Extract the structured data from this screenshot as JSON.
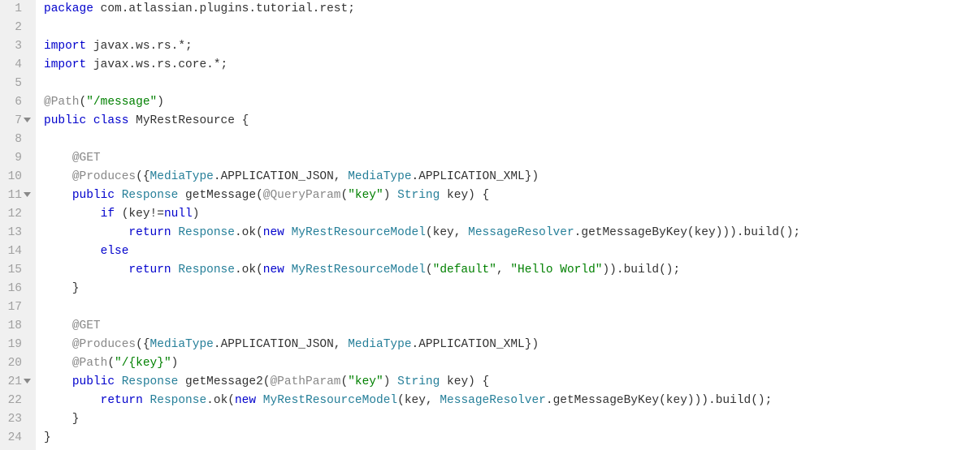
{
  "lines": [
    {
      "num": 1,
      "fold": false,
      "tokens": [
        {
          "cls": "kw",
          "t": "package"
        },
        {
          "cls": "plain",
          "t": " "
        },
        {
          "cls": "pkg",
          "t": "com.atlassian.plugins.tutorial.rest"
        },
        {
          "cls": "plain",
          "t": ";"
        }
      ]
    },
    {
      "num": 2,
      "fold": false,
      "tokens": []
    },
    {
      "num": 3,
      "fold": false,
      "tokens": [
        {
          "cls": "kw",
          "t": "import"
        },
        {
          "cls": "plain",
          "t": " javax.ws.rs.*;"
        }
      ]
    },
    {
      "num": 4,
      "fold": false,
      "tokens": [
        {
          "cls": "kw",
          "t": "import"
        },
        {
          "cls": "plain",
          "t": " javax.ws.rs.core.*;"
        }
      ]
    },
    {
      "num": 5,
      "fold": false,
      "tokens": []
    },
    {
      "num": 6,
      "fold": false,
      "tokens": [
        {
          "cls": "ann",
          "t": "@Path"
        },
        {
          "cls": "plain",
          "t": "("
        },
        {
          "cls": "str",
          "t": "\"/message\""
        },
        {
          "cls": "plain",
          "t": ")"
        }
      ]
    },
    {
      "num": 7,
      "fold": true,
      "tokens": [
        {
          "cls": "kw",
          "t": "public"
        },
        {
          "cls": "plain",
          "t": " "
        },
        {
          "cls": "kw",
          "t": "class"
        },
        {
          "cls": "plain",
          "t": " "
        },
        {
          "cls": "id",
          "t": "MyRestResource"
        },
        {
          "cls": "plain",
          "t": " {"
        }
      ]
    },
    {
      "num": 8,
      "fold": false,
      "tokens": []
    },
    {
      "num": 9,
      "fold": false,
      "tokens": [
        {
          "cls": "plain",
          "t": "    "
        },
        {
          "cls": "ann",
          "t": "@GET"
        }
      ]
    },
    {
      "num": 10,
      "fold": false,
      "tokens": [
        {
          "cls": "plain",
          "t": "    "
        },
        {
          "cls": "ann",
          "t": "@Produces"
        },
        {
          "cls": "plain",
          "t": "({"
        },
        {
          "cls": "type",
          "t": "MediaType"
        },
        {
          "cls": "plain",
          "t": ".APPLICATION_JSON, "
        },
        {
          "cls": "type",
          "t": "MediaType"
        },
        {
          "cls": "plain",
          "t": ".APPLICATION_XML})"
        }
      ]
    },
    {
      "num": 11,
      "fold": true,
      "tokens": [
        {
          "cls": "plain",
          "t": "    "
        },
        {
          "cls": "kw",
          "t": "public"
        },
        {
          "cls": "plain",
          "t": " "
        },
        {
          "cls": "type",
          "t": "Response"
        },
        {
          "cls": "plain",
          "t": " getMessage("
        },
        {
          "cls": "ann",
          "t": "@QueryParam"
        },
        {
          "cls": "plain",
          "t": "("
        },
        {
          "cls": "str",
          "t": "\"key\""
        },
        {
          "cls": "plain",
          "t": ") "
        },
        {
          "cls": "type",
          "t": "String"
        },
        {
          "cls": "plain",
          "t": " key) {"
        }
      ]
    },
    {
      "num": 12,
      "fold": false,
      "tokens": [
        {
          "cls": "plain",
          "t": "        "
        },
        {
          "cls": "kw",
          "t": "if"
        },
        {
          "cls": "plain",
          "t": " (key!="
        },
        {
          "cls": "kw",
          "t": "null"
        },
        {
          "cls": "plain",
          "t": ")"
        }
      ]
    },
    {
      "num": 13,
      "fold": false,
      "tokens": [
        {
          "cls": "plain",
          "t": "            "
        },
        {
          "cls": "kw",
          "t": "return"
        },
        {
          "cls": "plain",
          "t": " "
        },
        {
          "cls": "type",
          "t": "Response"
        },
        {
          "cls": "plain",
          "t": ".ok("
        },
        {
          "cls": "kw",
          "t": "new"
        },
        {
          "cls": "plain",
          "t": " "
        },
        {
          "cls": "type",
          "t": "MyRestResourceModel"
        },
        {
          "cls": "plain",
          "t": "(key, "
        },
        {
          "cls": "type",
          "t": "MessageResolver"
        },
        {
          "cls": "plain",
          "t": ".getMessageByKey(key))).build();"
        }
      ]
    },
    {
      "num": 14,
      "fold": false,
      "tokens": [
        {
          "cls": "plain",
          "t": "        "
        },
        {
          "cls": "kw",
          "t": "else"
        }
      ]
    },
    {
      "num": 15,
      "fold": false,
      "tokens": [
        {
          "cls": "plain",
          "t": "            "
        },
        {
          "cls": "kw",
          "t": "return"
        },
        {
          "cls": "plain",
          "t": " "
        },
        {
          "cls": "type",
          "t": "Response"
        },
        {
          "cls": "plain",
          "t": ".ok("
        },
        {
          "cls": "kw",
          "t": "new"
        },
        {
          "cls": "plain",
          "t": " "
        },
        {
          "cls": "type",
          "t": "MyRestResourceModel"
        },
        {
          "cls": "plain",
          "t": "("
        },
        {
          "cls": "str",
          "t": "\"default\""
        },
        {
          "cls": "plain",
          "t": ", "
        },
        {
          "cls": "str",
          "t": "\"Hello World\""
        },
        {
          "cls": "plain",
          "t": ")).build();"
        }
      ]
    },
    {
      "num": 16,
      "fold": false,
      "tokens": [
        {
          "cls": "plain",
          "t": "    }"
        }
      ]
    },
    {
      "num": 17,
      "fold": false,
      "tokens": []
    },
    {
      "num": 18,
      "fold": false,
      "tokens": [
        {
          "cls": "plain",
          "t": "    "
        },
        {
          "cls": "ann",
          "t": "@GET"
        }
      ]
    },
    {
      "num": 19,
      "fold": false,
      "tokens": [
        {
          "cls": "plain",
          "t": "    "
        },
        {
          "cls": "ann",
          "t": "@Produces"
        },
        {
          "cls": "plain",
          "t": "({"
        },
        {
          "cls": "type",
          "t": "MediaType"
        },
        {
          "cls": "plain",
          "t": ".APPLICATION_JSON, "
        },
        {
          "cls": "type",
          "t": "MediaType"
        },
        {
          "cls": "plain",
          "t": ".APPLICATION_XML})"
        }
      ]
    },
    {
      "num": 20,
      "fold": false,
      "tokens": [
        {
          "cls": "plain",
          "t": "    "
        },
        {
          "cls": "ann",
          "t": "@Path"
        },
        {
          "cls": "plain",
          "t": "("
        },
        {
          "cls": "str",
          "t": "\"/{key}\""
        },
        {
          "cls": "plain",
          "t": ")"
        }
      ]
    },
    {
      "num": 21,
      "fold": true,
      "tokens": [
        {
          "cls": "plain",
          "t": "    "
        },
        {
          "cls": "kw",
          "t": "public"
        },
        {
          "cls": "plain",
          "t": " "
        },
        {
          "cls": "type",
          "t": "Response"
        },
        {
          "cls": "plain",
          "t": " getMessage2("
        },
        {
          "cls": "ann",
          "t": "@PathParam"
        },
        {
          "cls": "plain",
          "t": "("
        },
        {
          "cls": "str",
          "t": "\"key\""
        },
        {
          "cls": "plain",
          "t": ") "
        },
        {
          "cls": "type",
          "t": "String"
        },
        {
          "cls": "plain",
          "t": " key) {"
        }
      ]
    },
    {
      "num": 22,
      "fold": false,
      "tokens": [
        {
          "cls": "plain",
          "t": "        "
        },
        {
          "cls": "kw",
          "t": "return"
        },
        {
          "cls": "plain",
          "t": " "
        },
        {
          "cls": "type",
          "t": "Response"
        },
        {
          "cls": "plain",
          "t": ".ok("
        },
        {
          "cls": "kw",
          "t": "new"
        },
        {
          "cls": "plain",
          "t": " "
        },
        {
          "cls": "type",
          "t": "MyRestResourceModel"
        },
        {
          "cls": "plain",
          "t": "(key, "
        },
        {
          "cls": "type",
          "t": "MessageResolver"
        },
        {
          "cls": "plain",
          "t": ".getMessageByKey(key))).build();"
        }
      ]
    },
    {
      "num": 23,
      "fold": false,
      "tokens": [
        {
          "cls": "plain",
          "t": "    }"
        }
      ]
    },
    {
      "num": 24,
      "fold": false,
      "tokens": [
        {
          "cls": "plain",
          "t": "}"
        }
      ]
    }
  ]
}
